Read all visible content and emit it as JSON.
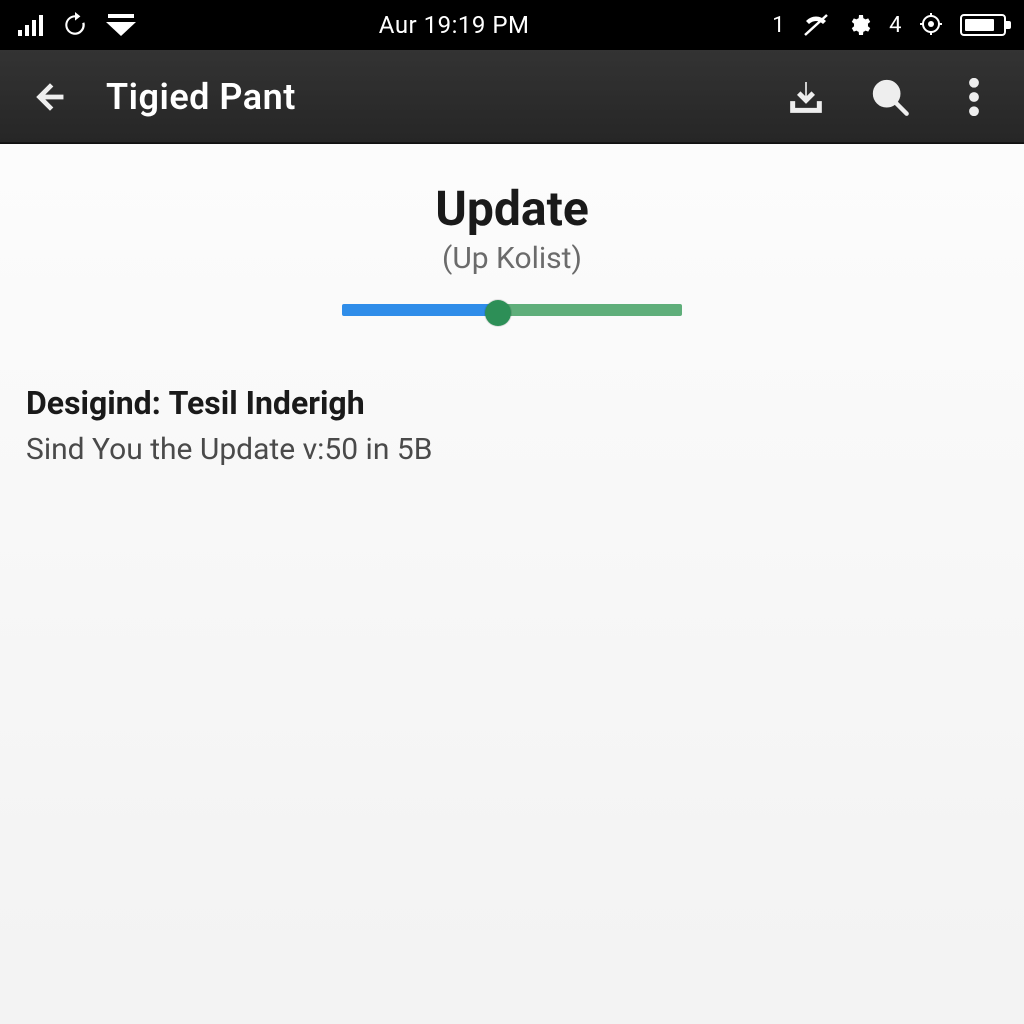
{
  "status_bar": {
    "clock": "Aur 19:19 PM",
    "right_text_1": "1",
    "right_text_2": "4"
  },
  "app_bar": {
    "title": "Tigied Pant"
  },
  "update": {
    "title": "Update",
    "subtitle": "(Up Kolist)",
    "progress_percent": 46
  },
  "description": {
    "label": "Desigind:",
    "value": "Tesil  Inderigh",
    "line2": "Sind You the Update v:50 in 5B"
  },
  "colors": {
    "progress_blue": "#2f8de9",
    "progress_green": "#5fae7a",
    "thumb": "#2d8f57"
  }
}
